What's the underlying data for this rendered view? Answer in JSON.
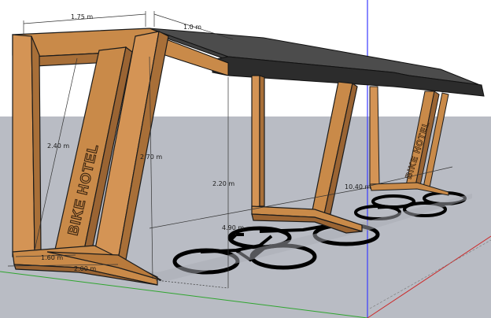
{
  "colors": {
    "sky": "#ffffff",
    "ground": "#b9bcc4",
    "wood": "#c98a49",
    "wood_dark": "#9a6433",
    "wood_light": "#dca56a",
    "roof": "#4a4a4a",
    "roof_dark": "#2e2e2e",
    "outline": "#1b1b1b",
    "axis_blue": "#3a3aff",
    "axis_green": "#2fa52f",
    "axis_red": "#cc2a2a",
    "bike_symbol": "#000000"
  },
  "model": {
    "sign_text": "BIKE HOTEL",
    "dimensions": {
      "frame_width": "1.75 m",
      "roof_depth": "1.0 m",
      "sign_height": "2.40 m",
      "post_height": "2.70 m",
      "clearance_height": "2.20 m",
      "total_length": "10.40 m",
      "bay_length": "4.90 m",
      "base_depth": "1.60 m",
      "base_width": "2.00 m"
    }
  }
}
